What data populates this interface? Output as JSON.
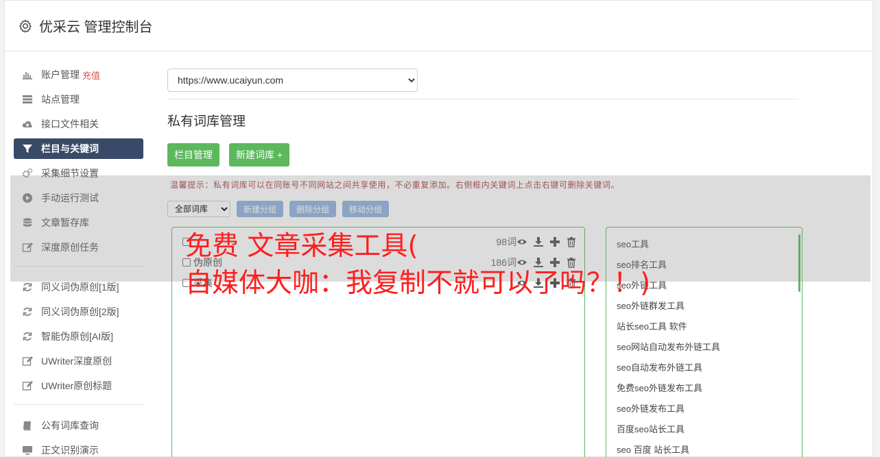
{
  "header": {
    "title": "优采云 管理控制台",
    "icon": "gear-icon"
  },
  "sidebar": {
    "items": [
      {
        "label": "账户管理",
        "badge": "充值",
        "icon": "bar-chart-icon"
      },
      {
        "label": "站点管理",
        "icon": "server-icon"
      },
      {
        "label": "接口文件相关",
        "icon": "cloud-upload-icon"
      },
      {
        "label": "栏目与关键词",
        "icon": "filter-icon",
        "active": true
      },
      {
        "label": "采集细节设置",
        "icon": "cogs-icon"
      },
      {
        "label": "手动运行测试",
        "icon": "play-circle-icon"
      },
      {
        "label": "文章暂存库",
        "icon": "database-icon"
      },
      {
        "label": "深度原创任务",
        "icon": "edit-icon"
      },
      {
        "label": "同义词伪原创[1版]",
        "icon": "refresh-icon"
      },
      {
        "label": "同义词伪原创[2版]",
        "icon": "refresh-icon"
      },
      {
        "label": "智能伪原创[AI版]",
        "icon": "refresh-icon"
      },
      {
        "label": "UWriter深度原创",
        "icon": "edit-icon"
      },
      {
        "label": "UWriter原创标题",
        "icon": "edit-icon"
      },
      {
        "label": "公有词库查询",
        "icon": "book-icon"
      },
      {
        "label": "正文识别演示",
        "icon": "monitor-icon"
      }
    ]
  },
  "main": {
    "site_select": "https://www.ucaiyun.com",
    "section_title": "私有词库管理",
    "buttons": {
      "column_manage": "栏目管理",
      "new_library": "新建词库 +"
    },
    "tip": "温馨提示：私有词库可以在同账号不同网站之间共享使用，不必重复添加。右侧框内关键词上点击右键可删除关键词。",
    "tools": {
      "library_select": "全部词库",
      "new_group": "新建分组",
      "delete_group": "删除分组",
      "move_group": "移动分组"
    },
    "libraries": [
      {
        "name": "",
        "count": "98词"
      },
      {
        "name": "伪原创",
        "count": "186词"
      },
      {
        "name": "采集",
        "count": ""
      }
    ],
    "keywords": [
      "seo工具",
      "seo排名工具",
      "seo外链工具",
      "seo外链群发工具",
      "站长seo工具 软件",
      "seo网站自动发布外链工具",
      "seo自动发布外链工具",
      "免费seo外链发布工具",
      "seo外链发布工具",
      "百度seo站长工具",
      "seo 百度 站长工具"
    ]
  },
  "overlay": {
    "line1": "免费 文章采集工具(",
    "line2": "自媒体大咖：我复制不就可以了吗？！)"
  },
  "colors": {
    "accent_green": "#5cb85c",
    "active_nav": "#394a68",
    "tip_red": "#a94442",
    "overlay_red": "#ff1e1e"
  }
}
